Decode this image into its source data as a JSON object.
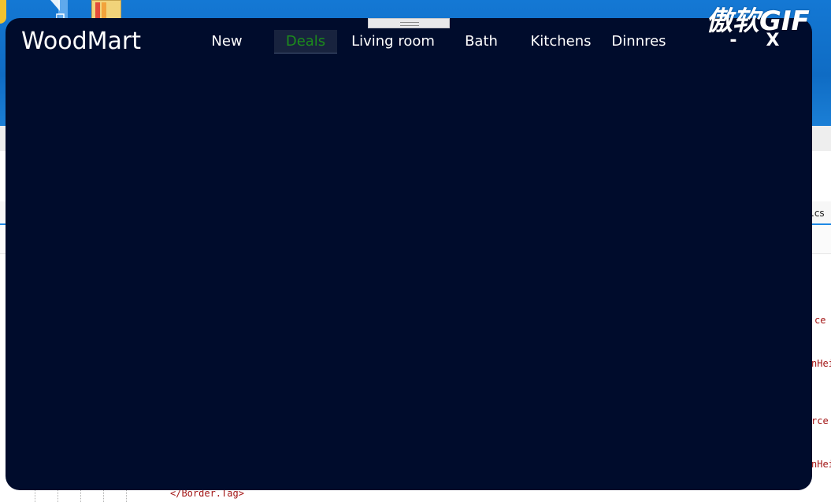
{
  "app": {
    "brand": "WoodMart",
    "nav": [
      {
        "label": "New",
        "active": false
      },
      {
        "label": "Deals",
        "active": true
      },
      {
        "label": "Living room",
        "active": false
      },
      {
        "label": "Bath",
        "active": false
      },
      {
        "label": "Kitchens",
        "active": false
      },
      {
        "label": "Dinnres",
        "active": false
      }
    ],
    "minimize_label": "-",
    "close_label": "X",
    "colors": {
      "window_bg": "#000c2c",
      "active_text": "#1c8c1c",
      "active_bg": "#18233e",
      "text": "#ffffff"
    }
  },
  "watermark": "傲软GIF",
  "background": {
    "code_fragments": [
      "ce",
      "nHei",
      "rce",
      "nHei",
      "</Border.Tag>"
    ],
    "file_tab": ".cs"
  }
}
